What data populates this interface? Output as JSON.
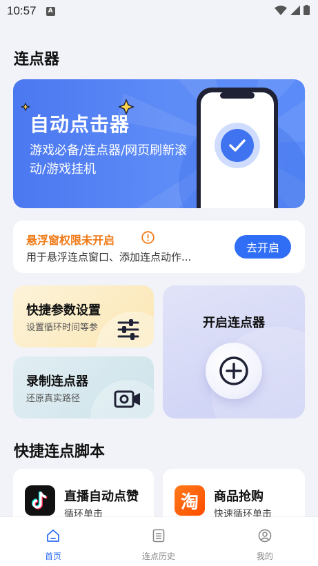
{
  "status_bar": {
    "time": "10:57"
  },
  "page": {
    "title": "连点器"
  },
  "banner": {
    "title": "自动点击器",
    "subtitle": "游戏必备/连点器/网页刷新滚动/游戏挂机"
  },
  "permission": {
    "title": "悬浮窗权限未开启",
    "description": "用于悬浮连点窗口、添加连点动作...",
    "button_label": "去开启"
  },
  "features": {
    "settings": {
      "title": "快捷参数设置",
      "subtitle": "设置循环时间等参"
    },
    "record": {
      "title": "录制连点器",
      "subtitle": "还原真实路径"
    },
    "start": {
      "title": "开启连点器"
    }
  },
  "scripts": {
    "section_title": "快捷连点脚本",
    "items": [
      {
        "title": "直播自动点赞",
        "subtitle": "循环单击",
        "icon": "tiktok-icon"
      },
      {
        "title": "商品抢购",
        "subtitle": "快速循环单击",
        "icon": "taobao-icon",
        "icon_text": "淘"
      }
    ]
  },
  "nav": {
    "items": [
      {
        "label": "首页",
        "icon": "home-icon",
        "active": true
      },
      {
        "label": "连点历史",
        "icon": "list-icon",
        "active": false
      },
      {
        "label": "我的",
        "icon": "profile-icon",
        "active": false
      }
    ]
  },
  "colors": {
    "accent": "#2f6ef5",
    "warning": "#f07a17",
    "banner": "#5a8bf8",
    "background": "#f1f3f8"
  }
}
